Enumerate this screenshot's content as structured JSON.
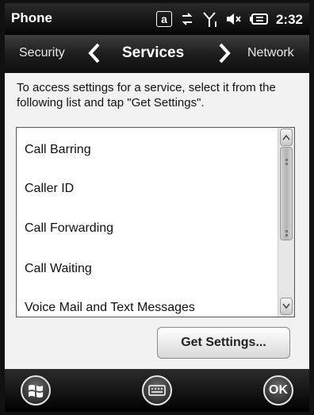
{
  "statusbar": {
    "title": "Phone",
    "at_symbol": "a",
    "time": "2:32",
    "icons": [
      "at-icon",
      "data-connection-icon",
      "signal-icon",
      "volume-muted-icon",
      "battery-charging-icon"
    ]
  },
  "navbar": {
    "prev_label": "Security",
    "title": "Services",
    "next_label": "Network"
  },
  "instructions": "To access settings for a service, select it from the following list and tap \"Get Settings\".",
  "services": [
    "Call Barring",
    "Caller ID",
    "Call Forwarding",
    "Call Waiting",
    "Voice Mail and Text Messages"
  ],
  "buttons": {
    "get_settings": "Get Settings...",
    "ok": "OK"
  },
  "bottombar": {
    "icons": [
      "windows-start-icon",
      "keyboard-icon"
    ]
  }
}
